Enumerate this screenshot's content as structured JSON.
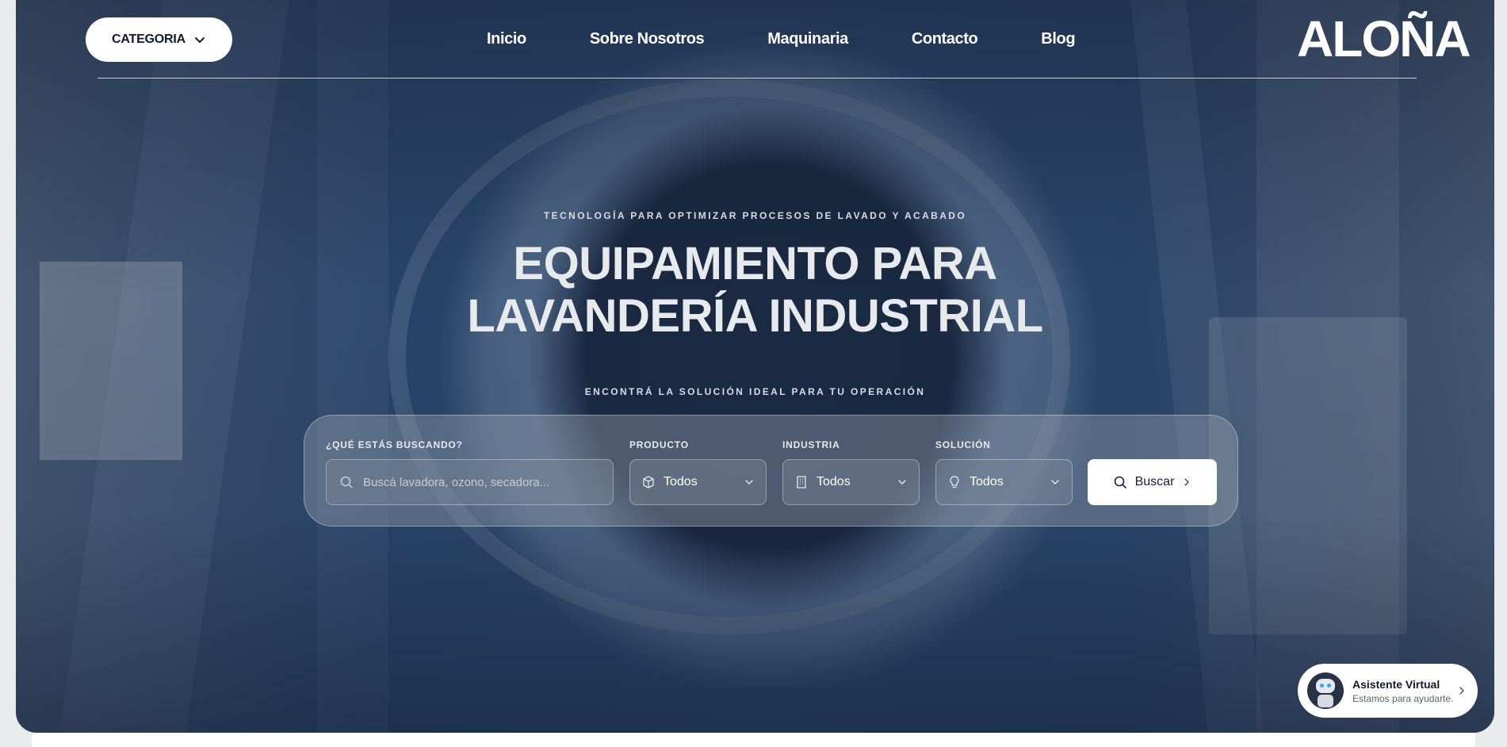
{
  "header": {
    "category_button": "CATEGORIA",
    "nav": [
      "Inicio",
      "Sobre Nosotros",
      "Maquinaria",
      "Contacto",
      "Blog"
    ],
    "logo": "ALOÑA"
  },
  "hero": {
    "eyebrow": "TECNOLOGÍA PARA OPTIMIZAR PROCESOS DE LAVADO Y ACABADO",
    "title_line1": "EQUIPAMIENTO PARA",
    "title_line2": "LAVANDERÍA INDUSTRIAL",
    "subtitle": "ENCONTRÁ LA SOLUCIÓN IDEAL PARA TU OPERACIÓN"
  },
  "search": {
    "query_label": "¿QUÉ ESTÁS BUSCANDO?",
    "query_placeholder": "Buscá lavadora, ozono, secadora...",
    "product_label": "PRODUCTO",
    "product_value": "Todos",
    "industry_label": "INDUSTRIA",
    "industry_value": "Todos",
    "solution_label": "SOLUCIÓN",
    "solution_value": "Todos",
    "submit_label": "Buscar"
  },
  "assistant": {
    "title": "Asistente Virtual",
    "subtitle": "Estamos para ayudarte."
  }
}
